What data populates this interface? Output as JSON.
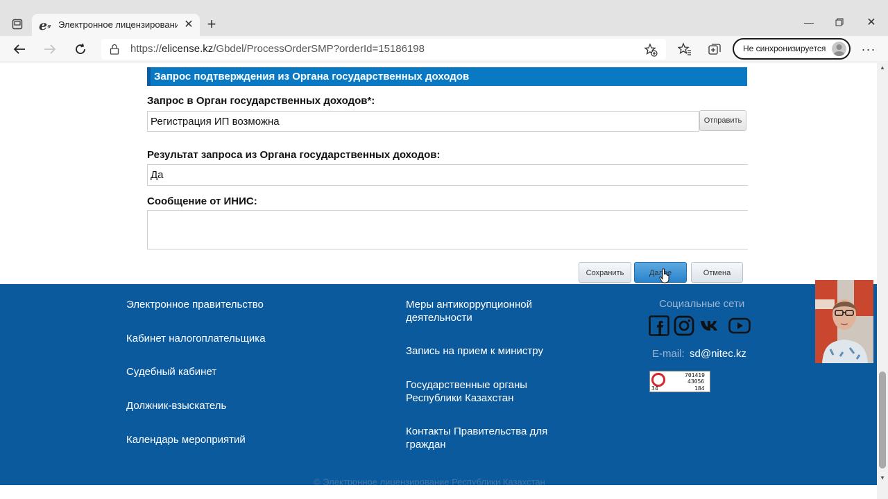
{
  "browser": {
    "tab_title": "Электронное лицензирование",
    "url_prefix": "https://",
    "url_host": "elicense.kz",
    "url_path": "/Gbdel/ProcessOrderSMP?orderId=15186198",
    "sync_label": "Не синхронизируется",
    "icons": [
      "tab-actions-icon",
      "edge-favicon-icon",
      "close-icon",
      "plus-icon",
      "minimize-icon",
      "restore-icon",
      "close-window-icon",
      "back-arrow-icon",
      "forward-arrow-icon",
      "refresh-icon",
      "lock-icon",
      "add-favorite-icon",
      "favorites-icon",
      "collections-icon",
      "avatar-icon",
      "more-icon"
    ]
  },
  "form": {
    "section_title": "Запрос подтверждения из Органа государственных доходов",
    "request_label": "Запрос в Орган государственных доходов*:",
    "request_value": "Регистрация ИП возможна",
    "send_button": "Отправить",
    "result_label": "Результат запроса из Органа государственных доходов:",
    "result_value": "Да",
    "message_label": "Сообщение от ИНИС:",
    "message_value": "",
    "save_button": "Сохранить",
    "next_button": "Далее",
    "cancel_button": "Отмена"
  },
  "footer": {
    "col1": [
      "Электронное правительство",
      "Кабинет налогоплательщика",
      "Судебный кабинет",
      "Должник-взыскатель",
      "Календарь мероприятий"
    ],
    "col2": [
      {
        "line1": "Меры антикоррупционной",
        "line2": "деятельности"
      },
      {
        "line1": "Запись на прием к министру",
        "line2": ""
      },
      {
        "line1": "Государственные органы",
        "line2": "Республики Казахстан"
      },
      {
        "line1": "Контакты Правительства для",
        "line2": "граждан"
      }
    ],
    "social_title": "Социальные сети",
    "social_icons": [
      "facebook-icon",
      "instagram-icon",
      "vk-icon",
      "youtube-icon"
    ],
    "email_label": "E-mail:",
    "email_value": "sd@nitec.kz",
    "counter": {
      "v1": "701419",
      "v2": "43056",
      "v3": "184",
      "v4": "34"
    },
    "copyright": "© Электронное лицензирование Республики Казахстан"
  },
  "colors": {
    "section_header": "#0979c4",
    "footer_bg": "#0c5a9e",
    "next_button": "#2a83cc"
  }
}
